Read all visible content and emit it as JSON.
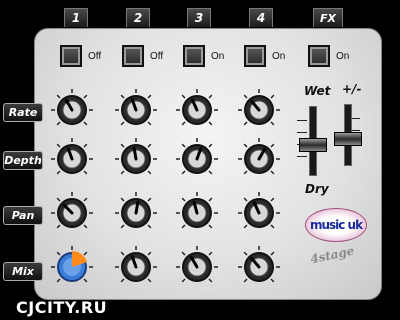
{
  "tabs": [
    {
      "label": "1"
    },
    {
      "label": "2"
    },
    {
      "label": "3"
    },
    {
      "label": "4"
    },
    {
      "label": "FX"
    }
  ],
  "toggles": [
    {
      "label": "Off"
    },
    {
      "label": "Off"
    },
    {
      "label": "On"
    },
    {
      "label": "On"
    },
    {
      "label": "On"
    }
  ],
  "rows": [
    {
      "label": "Rate"
    },
    {
      "label": "Depth"
    },
    {
      "label": "Pan"
    },
    {
      "label": "Mix"
    }
  ],
  "wet_label": "Wet",
  "plusminus_label": "+/-",
  "dry_label": "Dry",
  "logo_text": "music uk",
  "brand_text": "4stage",
  "watermark": "CJCITY.RU",
  "colors": {
    "accent_orange": "#ff8a1a",
    "accent_blue": "#3a7dd8",
    "logo_ink": "#1a2a9a"
  }
}
